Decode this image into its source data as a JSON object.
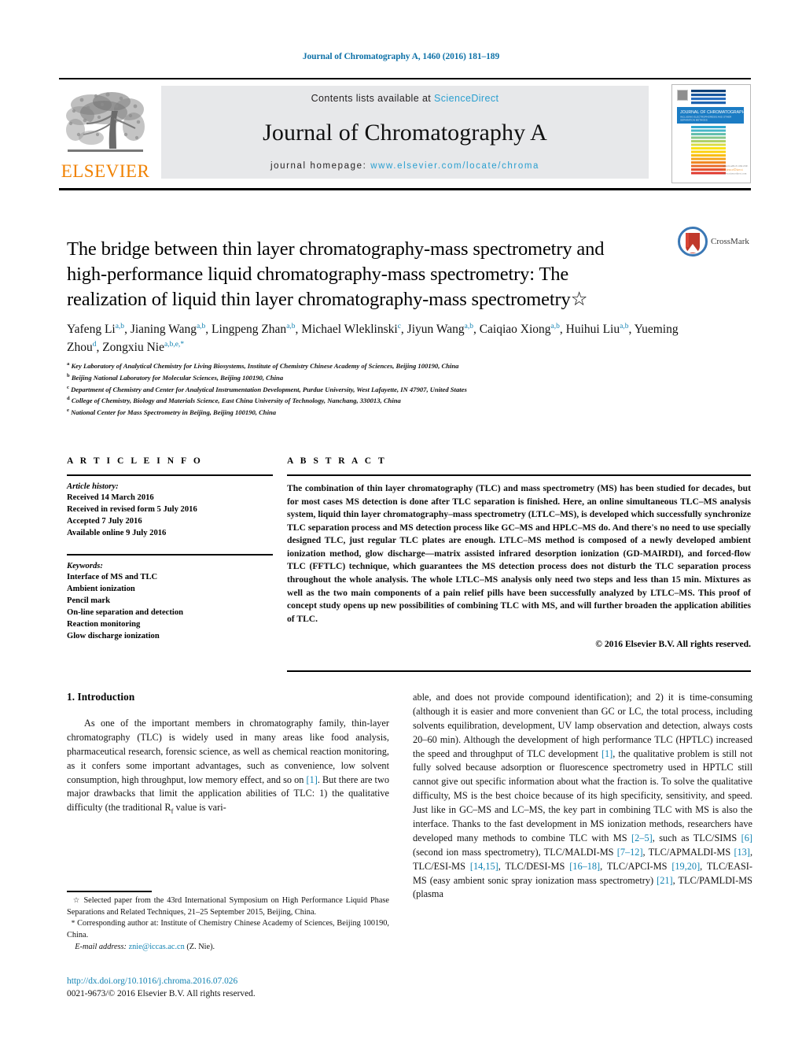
{
  "running_head": "Journal of Chromatography A, 1460 (2016) 181–189",
  "masthead": {
    "contents_prefix": "Contents lists available at ",
    "contents_link": "ScienceDirect",
    "journal_name": "Journal of Chromatography A",
    "homepage_prefix": "journal homepage: ",
    "homepage_url": "www.elsevier.com/locate/chroma",
    "publisher_wordmark": "ELSEVIER",
    "publisher_color": "#f08100",
    "link_color": "#2a9fd0",
    "cover_title": "JOURNAL OF CHROMATOGRAPHY A",
    "cover_subtitle": "INCLUDING ELECTROPHORESIS AND OTHER SEPARATION METHODS"
  },
  "crossmark": {
    "label": "CrossMark"
  },
  "article": {
    "title": "The bridge between thin layer chromatography-mass spectrometry and high-performance liquid chromatography-mass spectrometry: The realization of liquid thin layer chromatography-mass spectrometry",
    "title_footnote_mark": "☆",
    "authors_line_1": "Yafeng Li",
    "authors": [
      {
        "name": "Yafeng Li",
        "sup": "a,b"
      },
      {
        "name": "Jianing Wang",
        "sup": "a,b"
      },
      {
        "name": "Lingpeng Zhan",
        "sup": "a,b"
      },
      {
        "name": "Michael Wleklinski",
        "sup": "c"
      },
      {
        "name": "Jiyun Wang",
        "sup": "a,b"
      },
      {
        "name": "Caiqiao Xiong",
        "sup": "a,b"
      },
      {
        "name": "Huihui Liu",
        "sup": "a,b"
      },
      {
        "name": "Yueming Zhou",
        "sup": "d"
      },
      {
        "name": "Zongxiu Nie",
        "sup": "a,b,e,*"
      }
    ],
    "affiliations": [
      {
        "mark": "a",
        "text": "Key Laboratory of Analytical Chemistry for Living Biosystems, Institute of Chemistry Chinese Academy of Sciences, Beijing 100190, China"
      },
      {
        "mark": "b",
        "text": "Beijing National Laboratory for Molecular Sciences, Beijing 100190, China"
      },
      {
        "mark": "c",
        "text": "Department of Chemistry and Center for Analytical Instrumentation Development, Purdue University, West Lafayette, IN 47907, United States"
      },
      {
        "mark": "d",
        "text": "College of Chemistry, Biology and Materials Science, East China University of Technology, Nanchang, 330013, China"
      },
      {
        "mark": "e",
        "text": "National Center for Mass Spectrometry in Beijing, Beijing 100190, China"
      }
    ]
  },
  "article_info": {
    "heading": "A R T I C L E   I N F O",
    "history_heading": "Article history:",
    "history": [
      "Received 14 March 2016",
      "Received in revised form 5 July 2016",
      "Accepted 7 July 2016",
      "Available online 9 July 2016"
    ],
    "keywords_heading": "Keywords:",
    "keywords": [
      "Interface of MS and TLC",
      "Ambient ionization",
      "Pencil mark",
      "On-line separation and detection",
      "Reaction monitoring",
      "Glow discharge ionization"
    ]
  },
  "abstract": {
    "heading": "A B S T R A C T",
    "body": "The combination of thin layer chromatography (TLC) and mass spectrometry (MS) has been studied for decades, but for most cases MS detection is done after TLC separation is finished. Here, an online simultaneous TLC–MS analysis system, liquid thin layer chromatography–mass spectrometry (LTLC–MS), is developed which successfully synchronize TLC separation process and MS detection process like GC–MS and HPLC–MS do. And there's no need to use specially designed TLC, just regular TLC plates are enough. LTLC–MS method is composed of a newly developed ambient ionization method, glow discharge—matrix assisted infrared desorption ionization (GD-MAIRDI), and forced-flow TLC (FFTLC) technique, which guarantees the MS detection process does not disturb the TLC separation process throughout the whole analysis. The whole LTLC–MS analysis only need two steps and less than 15 min. Mixtures as well as the two main components of a pain relief pills have been successfully analyzed by LTLC–MS. This proof of concept study opens up new possibilities of combining TLC with MS, and will further broaden the application abilities of TLC.",
    "copyright": "© 2016 Elsevier B.V. All rights reserved."
  },
  "introduction": {
    "section_title": "1.  Introduction",
    "left_para_1": "As one of the important members in chromatography family, thin-layer chromatography (TLC) is widely used in many areas like food analysis, pharmaceutical research, forensic science, as well as chemical reaction monitoring, as it confers some important advantages, such as convenience, low solvent consumption, high throughput, low memory effect, and so on ",
    "left_ref_1": "[1]",
    "left_para_1b": ". But there are two major drawbacks that limit the application abilities of TLC: 1) the qualitative difficulty (the traditional R",
    "left_sub": "f",
    "left_para_1c": " value is vari-",
    "right_part_1": "able, and does not provide compound identification); and 2) it is time-consuming (although it is easier and more convenient than GC or LC, the total process, including solvents equilibration, development, UV lamp observation and detection, always costs 20–60 min). Although the development of high performance TLC (HPTLC) increased the speed and throughput of TLC development ",
    "right_ref_1": "[1]",
    "right_part_2": ", the qualitative problem is still not fully solved because adsorption or fluorescence spectrometry used in HPTLC still cannot give out specific information about what the fraction is. To solve the qualitative difficulty, MS is the best choice because of its high specificity, sensitivity, and speed. Just like in GC–MS and LC–MS, the key part in combining TLC with MS is also the interface. Thanks to the fast development in MS ionization methods, researchers have developed many methods to combine TLC with MS ",
    "right_ref_2": "[2–5]",
    "right_part_3": ", such as TLC/SIMS ",
    "right_ref_3": "[6]",
    "right_part_4": " (second ion mass spectrometry), TLC/MALDI-MS ",
    "right_ref_4": "[7–12]",
    "right_part_5": ", TLC/APMALDI-MS ",
    "right_ref_5": "[13]",
    "right_part_6": ", TLC/ESI-MS ",
    "right_ref_6": "[14,15]",
    "right_part_7": ", TLC/DESI-MS ",
    "right_ref_7": "[16–18]",
    "right_part_8": ", TLC/APCI-MS ",
    "right_ref_8": "[19,20]",
    "right_part_9": ", TLC/EASI-MS (easy ambient sonic spray ionization mass spectrometry) ",
    "right_ref_9": "[21]",
    "right_part_10": ", TLC/PAMLDI-MS (plasma"
  },
  "footnotes": {
    "star_mark": "☆",
    "star_text": "Selected paper from the 43rd International Symposium on High Performance Liquid Phase Separations and Related Techniques, 21–25 September 2015, Beijing, China.",
    "corr_mark": "*",
    "corr_text": "Corresponding author at: Institute of Chemistry Chinese Academy of Sciences, Beijing 100190, China.",
    "email_label": "E-mail address:",
    "email": "znie@iccas.ac.cn",
    "email_owner": "(Z. Nie)."
  },
  "doi_block": {
    "doi": "http://dx.doi.org/10.1016/j.chroma.2016.07.026",
    "issn_line": "0021-9673/© 2016 Elsevier B.V. All rights reserved."
  },
  "colors": {
    "accent_blue": "#1283b3",
    "header_blue": "#0f72a8",
    "orange": "#f08100",
    "band_gray": "#e7e8ea"
  }
}
